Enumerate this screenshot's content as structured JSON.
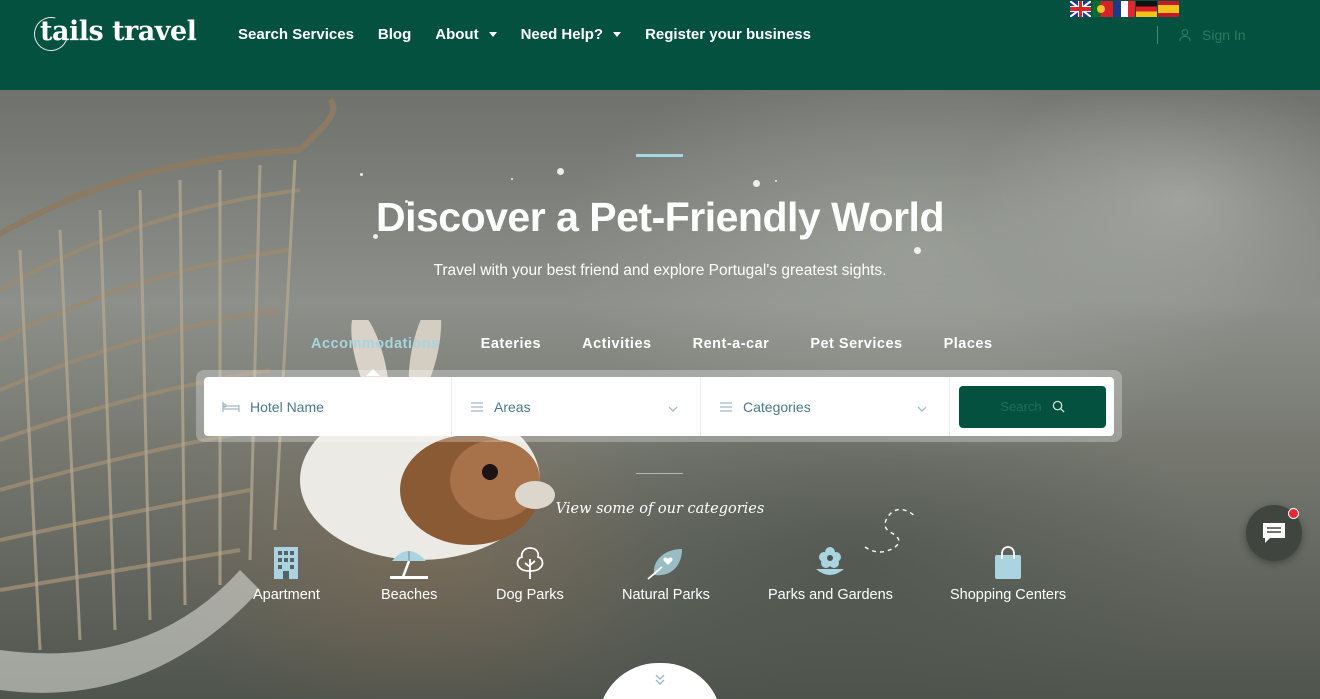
{
  "header": {
    "logo": "tails travel",
    "nav": [
      {
        "label": "Search Services",
        "dropdown": false
      },
      {
        "label": "Blog",
        "dropdown": false
      },
      {
        "label": "About",
        "dropdown": true
      },
      {
        "label": "Need Help?",
        "dropdown": true
      },
      {
        "label": "Register your business",
        "dropdown": false
      }
    ],
    "languages": [
      "english-flag",
      "portuguese-flag",
      "french-flag",
      "german-flag",
      "spanish-flag"
    ],
    "signin_label": "Sign In"
  },
  "hero": {
    "title": "Discover a Pet-Friendly World",
    "subtitle": "Travel with your best friend and explore Portugal's greatest sights.",
    "tabs": [
      {
        "label": "Accommodations",
        "active": true
      },
      {
        "label": "Eateries",
        "active": false
      },
      {
        "label": "Activities",
        "active": false
      },
      {
        "label": "Rent-a-car",
        "active": false
      },
      {
        "label": "Pet Services",
        "active": false
      },
      {
        "label": "Places",
        "active": false
      }
    ],
    "search": {
      "hotel_placeholder": "Hotel Name",
      "areas_label": "Areas",
      "categories_label": "Categories",
      "button_label": "Search"
    },
    "categories_heading": "View some of our categories",
    "categories": [
      {
        "label": "Apartment",
        "icon": "apartment-icon"
      },
      {
        "label": "Beaches",
        "icon": "beach-umbrella-icon"
      },
      {
        "label": "Dog Parks",
        "icon": "tree-icon"
      },
      {
        "label": "Natural Parks",
        "icon": "leaf-heart-icon"
      },
      {
        "label": "Parks and Gardens",
        "icon": "flower-pot-icon"
      },
      {
        "label": "Shopping Centers",
        "icon": "shopping-bag-icon"
      }
    ]
  },
  "colors": {
    "brand_green": "#04513f",
    "accent_blue": "#a9d4e0",
    "input_text": "#4a7891",
    "chat_badge": "#e8262f"
  }
}
